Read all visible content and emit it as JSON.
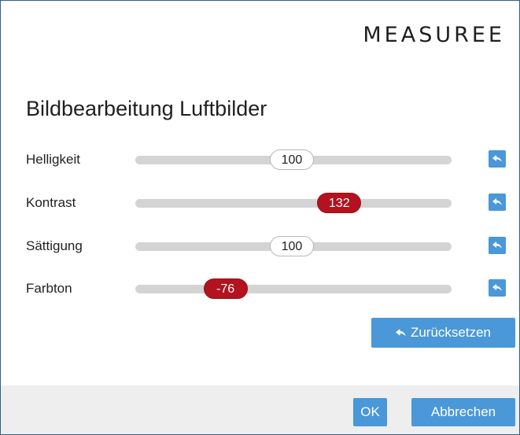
{
  "logo": {
    "text": "MEASUREE"
  },
  "dialog": {
    "title": "Bildbearbeitung Luftbilder"
  },
  "sliders": [
    {
      "label": "Helligkeit",
      "value": "100",
      "fraction": 0.495,
      "state": "neutral"
    },
    {
      "label": "Kontrast",
      "value": "132",
      "fraction": 0.645,
      "state": "changed"
    },
    {
      "label": "Sättigung",
      "value": "100",
      "fraction": 0.495,
      "state": "neutral"
    },
    {
      "label": "Farbton",
      "value": "-76",
      "fraction": 0.285,
      "state": "changed"
    }
  ],
  "actions": {
    "reset_all_label": "Zurücksetzen",
    "ok_label": "OK",
    "cancel_label": "Abbrechen"
  },
  "icons": {
    "row_reset": "reply-arrow-icon",
    "reset_all": "reply-arrow-icon"
  },
  "colors": {
    "accent": "#4a98d8",
    "changed_handle": "#b3121f",
    "track": "#d4d4d4",
    "border": "#2d5f86",
    "footer": "#eeeeee"
  }
}
